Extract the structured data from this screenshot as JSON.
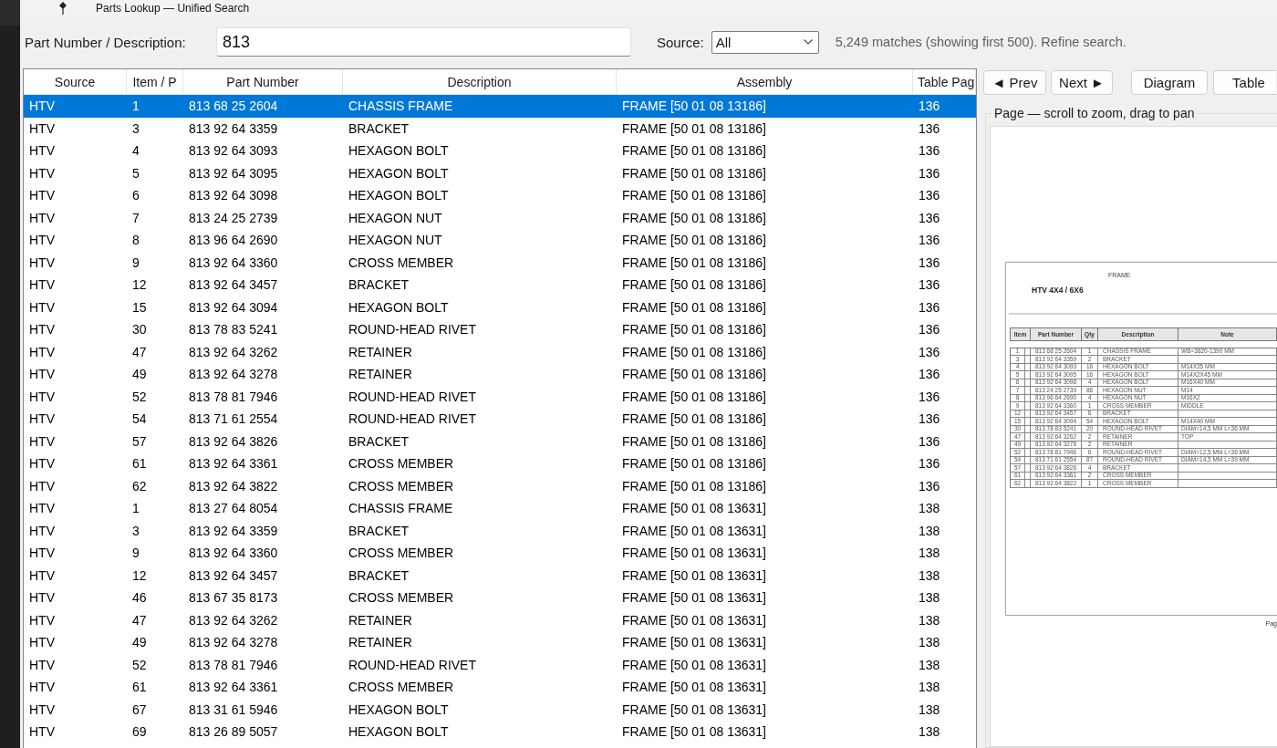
{
  "window": {
    "title": "Parts Lookup — Unified Search"
  },
  "search": {
    "label": "Part Number / Description:",
    "value": "813",
    "source_label": "Source:",
    "source_value": "All",
    "status": "5,249 matches (showing first 500). Refine search."
  },
  "table": {
    "columns": [
      "Source",
      "Item / P",
      "Part Number",
      "Description",
      "Assembly",
      "Table Pag"
    ],
    "rows": [
      {
        "selected": true,
        "cells": [
          "HTV",
          "1",
          "813 68 25 2604",
          "CHASSIS FRAME",
          "FRAME [50 01 08 13186]",
          "136"
        ]
      },
      {
        "selected": false,
        "cells": [
          "HTV",
          "3",
          "813 92 64 3359",
          "BRACKET",
          "FRAME [50 01 08 13186]",
          "136"
        ]
      },
      {
        "selected": false,
        "cells": [
          "HTV",
          "4",
          "813 92 64 3093",
          "HEXAGON BOLT",
          "FRAME [50 01 08 13186]",
          "136"
        ]
      },
      {
        "selected": false,
        "cells": [
          "HTV",
          "5",
          "813 92 64 3095",
          "HEXAGON BOLT",
          "FRAME [50 01 08 13186]",
          "136"
        ]
      },
      {
        "selected": false,
        "cells": [
          "HTV",
          "6",
          "813 92 64 3098",
          "HEXAGON BOLT",
          "FRAME [50 01 08 13186]",
          "136"
        ]
      },
      {
        "selected": false,
        "cells": [
          "HTV",
          "7",
          "813 24 25 2739",
          "HEXAGON NUT",
          "FRAME [50 01 08 13186]",
          "136"
        ]
      },
      {
        "selected": false,
        "cells": [
          "HTV",
          "8",
          "813 96 64 2690",
          "HEXAGON NUT",
          "FRAME [50 01 08 13186]",
          "136"
        ]
      },
      {
        "selected": false,
        "cells": [
          "HTV",
          "9",
          "813 92 64 3360",
          "CROSS MEMBER",
          "FRAME [50 01 08 13186]",
          "136"
        ]
      },
      {
        "selected": false,
        "cells": [
          "HTV",
          "12",
          "813 92 64 3457",
          "BRACKET",
          "FRAME [50 01 08 13186]",
          "136"
        ]
      },
      {
        "selected": false,
        "cells": [
          "HTV",
          "15",
          "813 92 64 3094",
          "HEXAGON BOLT",
          "FRAME [50 01 08 13186]",
          "136"
        ]
      },
      {
        "selected": false,
        "cells": [
          "HTV",
          "30",
          "813 78 83 5241",
          "ROUND-HEAD RIVET",
          "FRAME [50 01 08 13186]",
          "136"
        ]
      },
      {
        "selected": false,
        "cells": [
          "HTV",
          "47",
          "813 92 64 3262",
          "RETAINER",
          "FRAME [50 01 08 13186]",
          "136"
        ]
      },
      {
        "selected": false,
        "cells": [
          "HTV",
          "49",
          "813 92 64 3278",
          "RETAINER",
          "FRAME [50 01 08 13186]",
          "136"
        ]
      },
      {
        "selected": false,
        "cells": [
          "HTV",
          "52",
          "813 78 81 7946",
          "ROUND-HEAD RIVET",
          "FRAME [50 01 08 13186]",
          "136"
        ]
      },
      {
        "selected": false,
        "cells": [
          "HTV",
          "54",
          "813 71 61 2554",
          "ROUND-HEAD RIVET",
          "FRAME [50 01 08 13186]",
          "136"
        ]
      },
      {
        "selected": false,
        "cells": [
          "HTV",
          "57",
          "813 92 64 3826",
          "BRACKET",
          "FRAME [50 01 08 13186]",
          "136"
        ]
      },
      {
        "selected": false,
        "cells": [
          "HTV",
          "61",
          "813 92 64 3361",
          "CROSS MEMBER",
          "FRAME [50 01 08 13186]",
          "136"
        ]
      },
      {
        "selected": false,
        "cells": [
          "HTV",
          "62",
          "813 92 64 3822",
          "CROSS MEMBER",
          "FRAME [50 01 08 13186]",
          "136"
        ]
      },
      {
        "selected": false,
        "cells": [
          "HTV",
          "1",
          "813 27 64 8054",
          "CHASSIS FRAME",
          "FRAME [50 01 08 13631]",
          "138"
        ]
      },
      {
        "selected": false,
        "cells": [
          "HTV",
          "3",
          "813 92 64 3359",
          "BRACKET",
          "FRAME [50 01 08 13631]",
          "138"
        ]
      },
      {
        "selected": false,
        "cells": [
          "HTV",
          "9",
          "813 92 64 3360",
          "CROSS MEMBER",
          "FRAME [50 01 08 13631]",
          "138"
        ]
      },
      {
        "selected": false,
        "cells": [
          "HTV",
          "12",
          "813 92 64 3457",
          "BRACKET",
          "FRAME [50 01 08 13631]",
          "138"
        ]
      },
      {
        "selected": false,
        "cells": [
          "HTV",
          "46",
          "813 67 35 8173",
          "CROSS MEMBER",
          "FRAME [50 01 08 13631]",
          "138"
        ]
      },
      {
        "selected": false,
        "cells": [
          "HTV",
          "47",
          "813 92 64 3262",
          "RETAINER",
          "FRAME [50 01 08 13631]",
          "138"
        ]
      },
      {
        "selected": false,
        "cells": [
          "HTV",
          "49",
          "813 92 64 3278",
          "RETAINER",
          "FRAME [50 01 08 13631]",
          "138"
        ]
      },
      {
        "selected": false,
        "cells": [
          "HTV",
          "52",
          "813 78 81 7946",
          "ROUND-HEAD RIVET",
          "FRAME [50 01 08 13631]",
          "138"
        ]
      },
      {
        "selected": false,
        "cells": [
          "HTV",
          "61",
          "813 92 64 3361",
          "CROSS MEMBER",
          "FRAME [50 01 08 13631]",
          "138"
        ]
      },
      {
        "selected": false,
        "cells": [
          "HTV",
          "67",
          "813 31 61 5946",
          "HEXAGON BOLT",
          "FRAME [50 01 08 13631]",
          "138"
        ]
      },
      {
        "selected": false,
        "cells": [
          "HTV",
          "69",
          "813 26 89 5057",
          "HEXAGON BOLT",
          "FRAME [50 01 08 13631]",
          "138"
        ]
      }
    ]
  },
  "viewer": {
    "nav_buttons": [
      "◄ Prev",
      "Next ►"
    ],
    "view_buttons": [
      "Diagram",
      "Table"
    ],
    "group_label": "Page — scroll to zoom, drag to pan",
    "page": {
      "heading": "FRAME",
      "title": "HTV 4X4 / 6X6",
      "columns": [
        "Item",
        "Part Number",
        "Qty",
        "Description",
        "Note"
      ],
      "rows": [
        {
          "item": "1",
          "part": "813 68 25 2604",
          "qty": "1",
          "description": "CHASSIS FRAME",
          "note": "WB=3820-1390 MM"
        },
        {
          "item": "3",
          "part": "813 92 64 3359",
          "qty": "2",
          "description": "BRACKET"
        },
        {
          "item": "4",
          "part": "813 92 64 3093",
          "qty": "16",
          "description": "HEXAGON BOLT",
          "note": "M14X35 MM"
        },
        {
          "item": "5",
          "part": "813 92 64 3095",
          "qty": "16",
          "description": "HEXAGON BOLT",
          "note": "M14X2X45 MM"
        },
        {
          "item": "6",
          "part": "813 92 64 3098",
          "qty": "4",
          "description": "HEXAGON BOLT",
          "note": "M16X40 MM"
        },
        {
          "item": "7",
          "part": "813 24 25 2739",
          "qty": "86",
          "description": "HEXAGON NUT",
          "note": "M14"
        },
        {
          "item": "8",
          "part": "813 96 64 2690",
          "qty": "4",
          "description": "HEXAGON NUT",
          "note": "M16X2"
        },
        {
          "item": "9",
          "part": "813 92 64 3360",
          "qty": "1",
          "description": "CROSS MEMBER",
          "note": "MIDDLE"
        },
        {
          "item": "12",
          "part": "813 92 64 3457",
          "qty": "6",
          "description": "BRACKET"
        },
        {
          "item": "15",
          "part": "813 92 64 3094",
          "qty": "54",
          "description": "HEXAGON BOLT",
          "note": "M14X40 MM"
        },
        {
          "item": "30",
          "part": "813 78 83 5241",
          "qty": "20",
          "description": "ROUND-HEAD RIVET",
          "note": "DIAM=14,5 MM L=36 MM"
        },
        {
          "item": "47",
          "part": "813 92 64 3262",
          "qty": "2",
          "description": "RETAINER",
          "note": "TOP"
        },
        {
          "item": "49",
          "part": "813 92 64 3278",
          "qty": "2",
          "description": "RETAINER"
        },
        {
          "item": "52",
          "part": "813 78 81 7946",
          "qty": "6",
          "description": "ROUND-HEAD RIVET",
          "note": "DIAM=12,5 MM L=36 MM"
        },
        {
          "item": "54",
          "part": "813 71 61 2554",
          "qty": "87",
          "description": "ROUND-HEAD RIVET",
          "note": "DIAM=14,5 MM L=39 MM"
        },
        {
          "item": "57",
          "part": "813 92 64 3826",
          "qty": "4",
          "description": "BRACKET"
        },
        {
          "item": "61",
          "part": "813 92 64 3361",
          "qty": "2",
          "description": "CROSS MEMBER"
        },
        {
          "item": "62",
          "part": "813 92 64 3822",
          "qty": "1",
          "description": "CROSS MEMBER"
        }
      ]
    },
    "page_number": "Pag"
  }
}
